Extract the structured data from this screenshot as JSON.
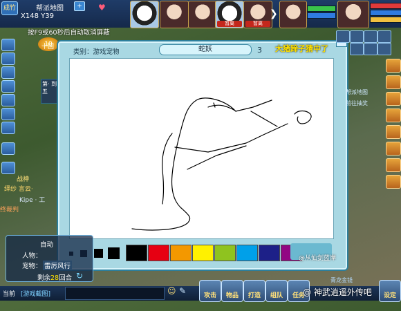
{
  "topbar": {
    "location_icon": "成竹",
    "map_name": "帮派地图",
    "plus": "+",
    "coords": "X148  Y39",
    "avatars": [
      {
        "tag": ""
      },
      {
        "tag": ""
      },
      {
        "tag": ""
      },
      {
        "tag": "暂离"
      },
      {
        "tag": "暂离"
      }
    ],
    "colors": {
      "hp": "#3ac34a",
      "mp": "#2f7be0",
      "hp_low": "#e03a3a"
    }
  },
  "notice": "按F9或60秒后自动取消屏蔽",
  "behind_dialog": {
    "tenth": "10",
    "ten_label": "十回",
    "side_card": "第·  到五"
  },
  "left_labels": {
    "battle": "战神",
    "guild": "绎纱 言云·",
    "kipe": "Kipe · 工",
    "kill": "终裁判"
  },
  "dialog": {
    "category": "类别：游戏宠物",
    "word": "蛇妖",
    "count": "3",
    "guesser": "大猪蹄子猜中了",
    "close": "X"
  },
  "palette": {
    "colors": [
      "#000000",
      "#e60012",
      "#f39800",
      "#fff100",
      "#8fc31f",
      "#00a0e9",
      "#1d2088",
      "#920783"
    ],
    "watermark": "@从仙剑蓝岸"
  },
  "right_side": {
    "text1": "帮派地图",
    "text2": "前往抽奖"
  },
  "auto_panel": {
    "title": "自动",
    "char_label": "人物：",
    "pet_label": "宠物：",
    "pet_value": "雷厉风行",
    "remain_prefix": "剩余",
    "remain_num": "28",
    "remain_suffix": "回合"
  },
  "chat": {
    "channel": "当前",
    "msg": "[游戏截图]"
  },
  "menu": [
    "攻击",
    "物品",
    "打造",
    "组队",
    "任务",
    "设定"
  ],
  "watermark2": "@ 神武逍遥外传吧",
  "bottom_right": "青龙金钱"
}
